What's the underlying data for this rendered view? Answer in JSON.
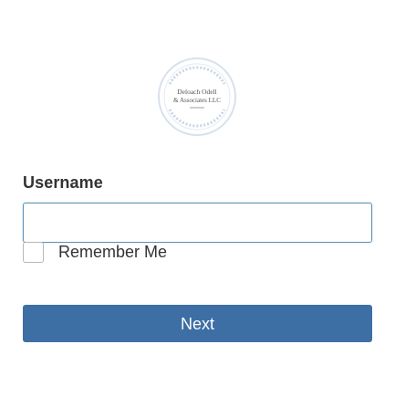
{
  "logo": {
    "name": "Deloach Odell & Associates LLC",
    "line1": "Deloach Odell",
    "line2": "& Associates LLC",
    "ring_color": "#c9d6e6",
    "text_color": "#555555"
  },
  "form": {
    "username_label": "Username",
    "username_value": "",
    "username_placeholder": "",
    "remember_label": "Remember Me",
    "remember_checked": false,
    "next_label": "Next"
  },
  "colors": {
    "button_bg": "#3d6fa5",
    "button_text": "#ffffff",
    "input_border": "#5c93b8",
    "label_text": "#333333"
  }
}
